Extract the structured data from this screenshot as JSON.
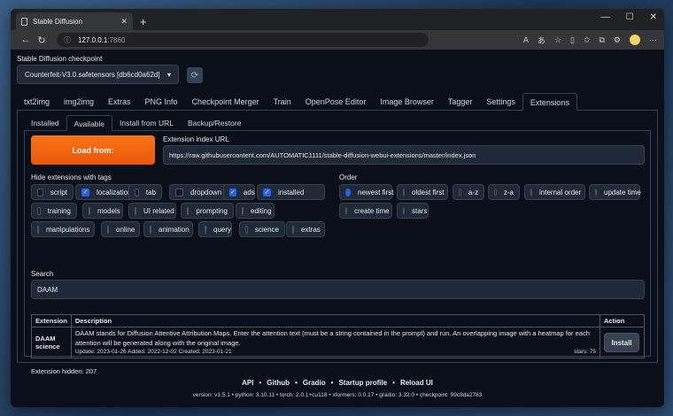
{
  "browser": {
    "tab_title": "Stable Diffusion",
    "url_host": "127.0.0.1",
    "url_port": ":7860"
  },
  "checkpoint": {
    "label": "Stable Diffusion checkpoint",
    "value": "Counterfeit-V3.0.safetensors [db6cd0a62d]"
  },
  "main_tabs": [
    "txt2img",
    "img2img",
    "Extras",
    "PNG Info",
    "Checkpoint Merger",
    "Train",
    "OpenPose Editor",
    "Image Browser",
    "Tagger",
    "Settings",
    "Extensions"
  ],
  "sub_tabs": [
    "Installed",
    "Available",
    "Install from URL",
    "Backup/Restore"
  ],
  "load_button": "Load from:",
  "index_url": {
    "label": "Extension index URL",
    "value": "https://raw.githubusercontent.com/AUTOMATIC1111/stable-diffusion-webui-extensions/master/index.json"
  },
  "hide_tags": {
    "label": "Hide extensions with tags",
    "items": [
      {
        "label": "script",
        "checked": false
      },
      {
        "label": "localization",
        "checked": true
      },
      {
        "label": "tab",
        "checked": false
      },
      {
        "label": "dropdown",
        "checked": false
      },
      {
        "label": "ads",
        "checked": true
      },
      {
        "label": "installed",
        "checked": true
      },
      {
        "label": "training",
        "checked": false
      },
      {
        "label": "models",
        "checked": false
      },
      {
        "label": "UI related",
        "checked": false
      },
      {
        "label": "prompting",
        "checked": false
      },
      {
        "label": "editing",
        "checked": false
      },
      {
        "label": "manipulations",
        "checked": false
      },
      {
        "label": "online",
        "checked": false
      },
      {
        "label": "animation",
        "checked": false
      },
      {
        "label": "query",
        "checked": false
      },
      {
        "label": "science",
        "checked": false
      },
      {
        "label": "extras",
        "checked": false
      }
    ]
  },
  "order": {
    "label": "Order",
    "items": [
      {
        "label": "newest first",
        "selected": true
      },
      {
        "label": "oldest first",
        "selected": false
      },
      {
        "label": "a-z",
        "selected": false
      },
      {
        "label": "z-a",
        "selected": false
      },
      {
        "label": "internal order",
        "selected": false
      },
      {
        "label": "update time",
        "selected": false
      },
      {
        "label": "create time",
        "selected": false
      },
      {
        "label": "stars",
        "selected": false
      }
    ]
  },
  "search": {
    "label": "Search",
    "value": "DAAM"
  },
  "table": {
    "headers": [
      "Extension",
      "Description",
      "Action"
    ],
    "rows": [
      {
        "name": "DAAM science",
        "description": "DAAM stands for Diffusion Attentive Attribution Maps. Enter the attention text (must be a string contained in the prompt) and run. An overlapping image with a heatmap for each attention will be generated along with the original image.",
        "meta": "Update: 2023-01-26 Added: 2022-12-02 Created: 2023-01-21",
        "stars": "stars: 75",
        "action": "Install"
      }
    ]
  },
  "hidden_count": "Extension hidden: 207",
  "footer": {
    "links": [
      "API",
      "Github",
      "Gradio",
      "Startup profile",
      "Reload UI"
    ],
    "versions": "version: v1.5.1  •  python: 3.10.11  •  torch: 2.0.1+cu118  •  xformers: 0.0.17  •  gradio: 3.32.0  •  checkpoint: 99c8da2783"
  }
}
